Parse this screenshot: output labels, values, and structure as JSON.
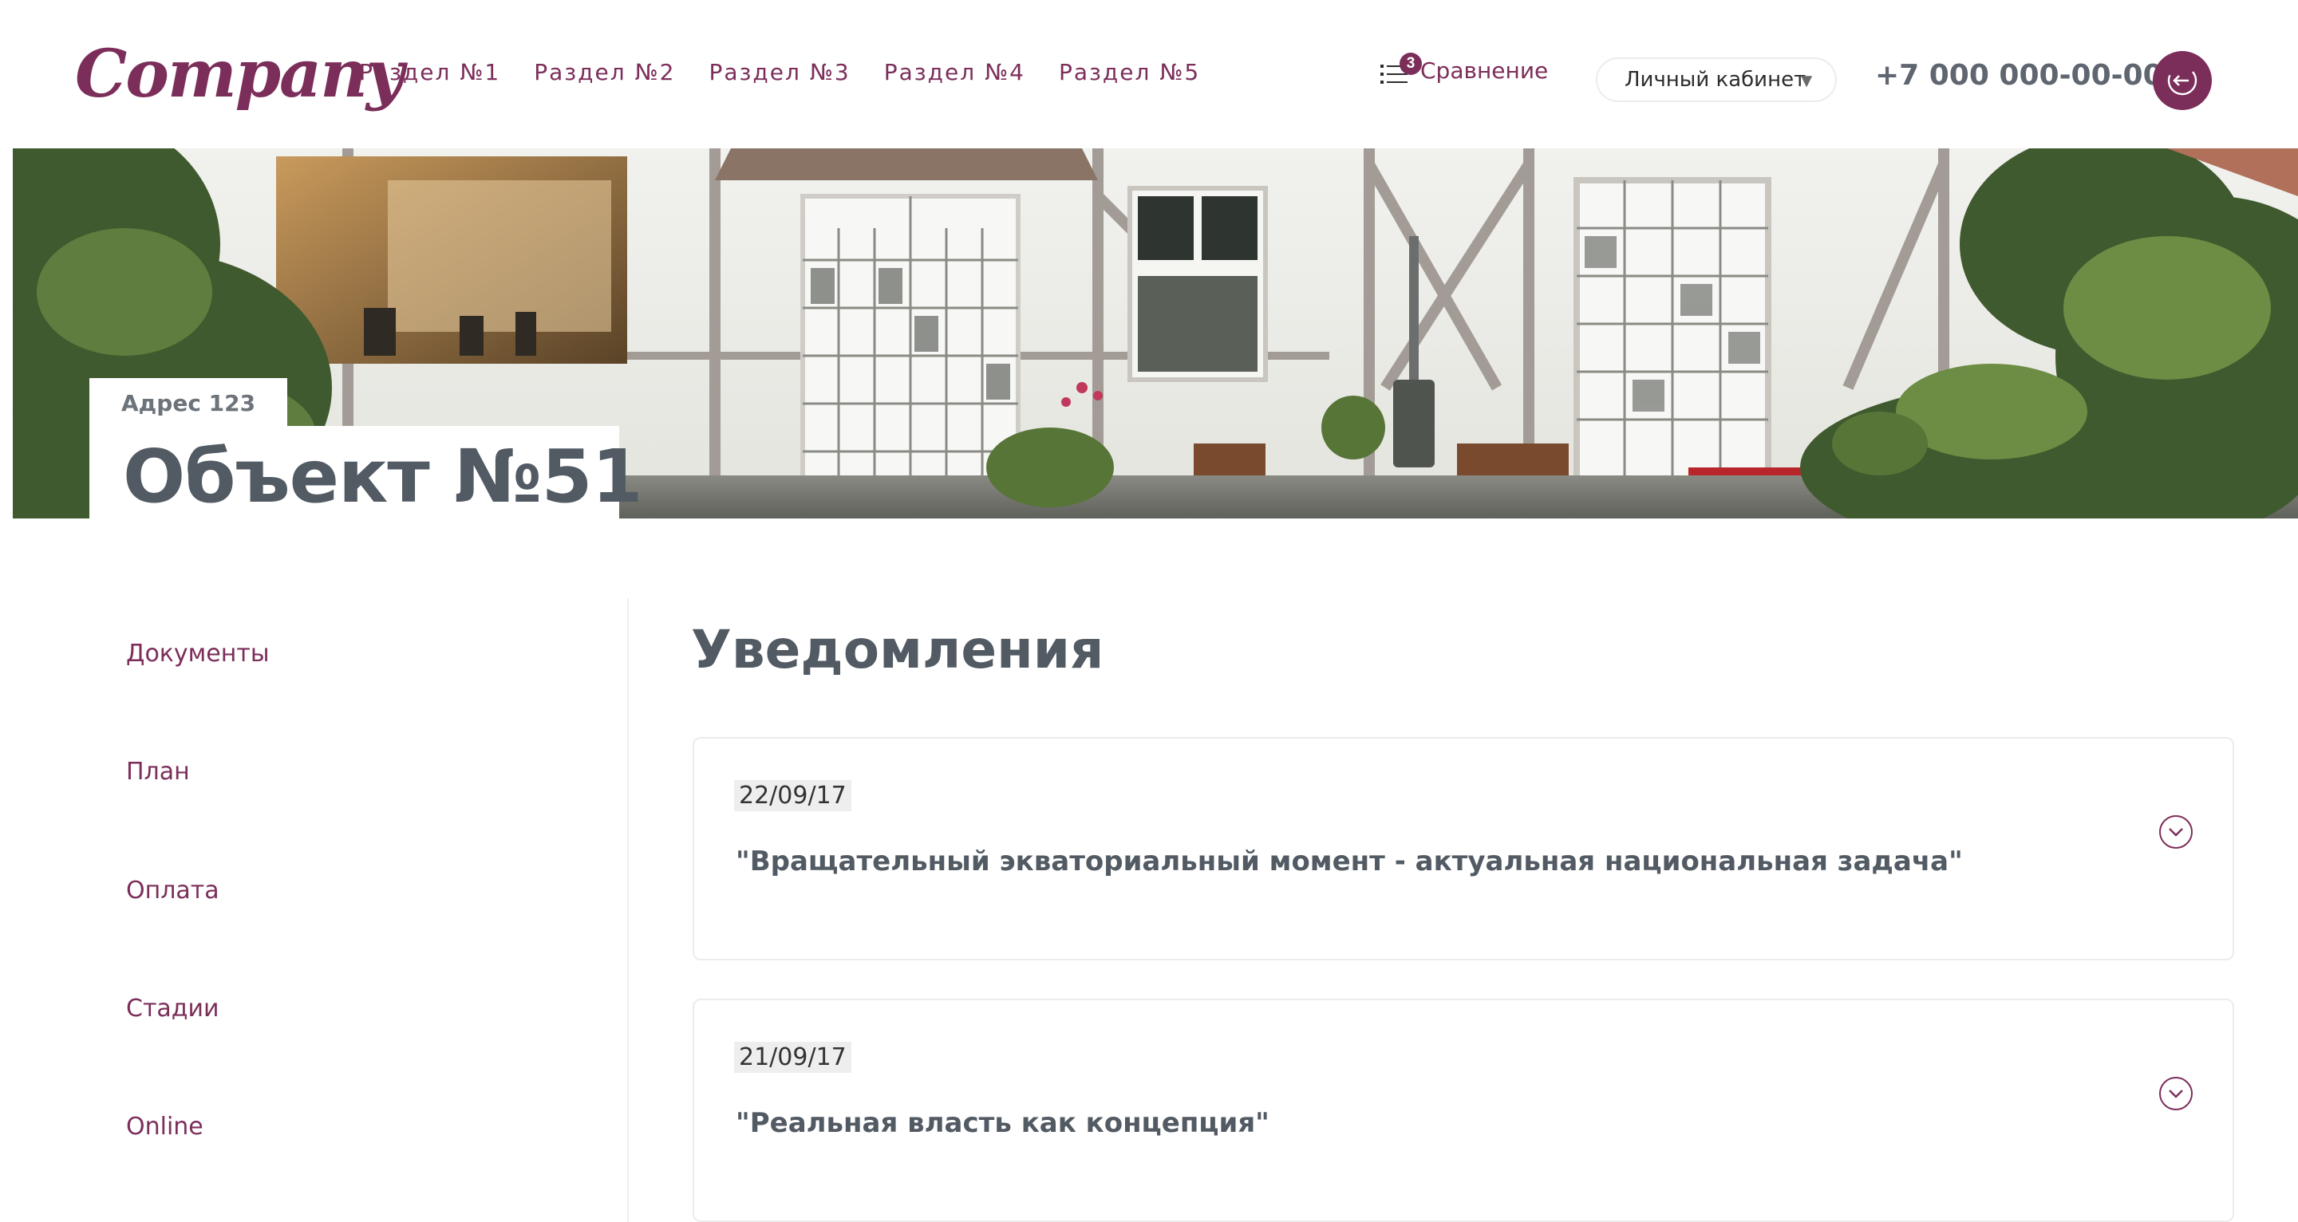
{
  "header": {
    "logo": "Company",
    "nav": [
      "Раздел №1",
      "Раздел №2",
      "Раздел №3",
      "Раздел №4",
      "Раздел №5"
    ],
    "compare": {
      "label": "Сравнение",
      "count": "3"
    },
    "cabinet": {
      "label": "Личный кабинет",
      "caret": "▼"
    },
    "phone": "+7 000 000-00-00",
    "logout_icon": "logout-icon"
  },
  "hero": {
    "address": "Адрес 123",
    "title": "Объект №51"
  },
  "sidebar": {
    "items": [
      "Документы",
      "План",
      "Оплата",
      "Стадии",
      "Online"
    ]
  },
  "main": {
    "title": "Уведомления",
    "notifications": [
      {
        "date": "22/09/17",
        "text": "\"Вращательный экваториальный момент - актуальная национальная задача\""
      },
      {
        "date": "21/09/17",
        "text": "\"Реальная власть как концепция\""
      }
    ]
  },
  "colors": {
    "accent": "#7c2e5a",
    "text_dark": "#525a63",
    "border": "#ececec"
  }
}
